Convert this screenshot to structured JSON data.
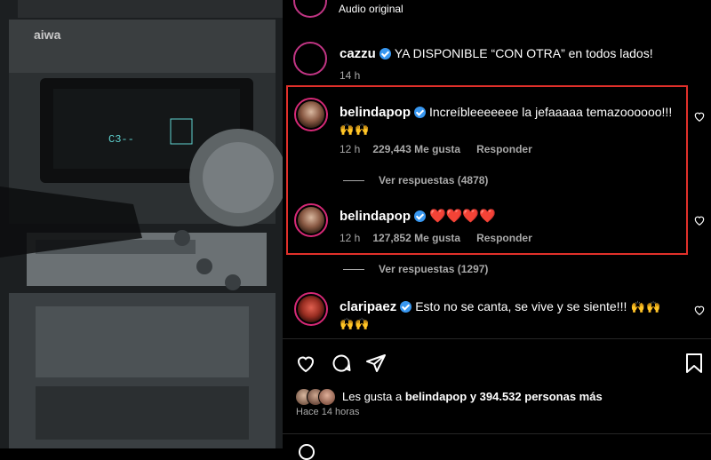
{
  "top": {
    "subtitle": "Audio original"
  },
  "comments": [
    {
      "user": "cazzu",
      "text": "YA DISPONIBLE “CON OTRA” en todos lados!",
      "time": "14 h"
    },
    {
      "user": "belindapop",
      "text": "Increíbleeeeeee la jefaaaaa temazoooooo!!!",
      "emoji": "🙌🙌",
      "time": "12 h",
      "likes": "229,443 Me gusta",
      "reply": "Responder",
      "view_replies": "Ver respuestas (4878)"
    },
    {
      "user": "belindapop",
      "text": "❤️❤️❤️❤️",
      "time": "12 h",
      "likes": "127,852 Me gusta",
      "reply": "Responder",
      "view_replies": "Ver respuestas (1297)"
    },
    {
      "user": "claripaez",
      "text": "Esto no se canta, se vive y se siente!!!",
      "emoji": "🙌🙌",
      "emoji2": "🙌🙌"
    }
  ],
  "footer": {
    "likes_prefix": "Les gusta a",
    "likes_user": "belindapop",
    "likes_suffix": "y 394.532 personas más",
    "time": "Hace 14 horas"
  },
  "media": {
    "brand": "aiwa",
    "display": "C3--"
  },
  "icons": [
    "heart-icon",
    "comment-icon",
    "share-icon",
    "bookmark-icon",
    "verified-icon"
  ]
}
